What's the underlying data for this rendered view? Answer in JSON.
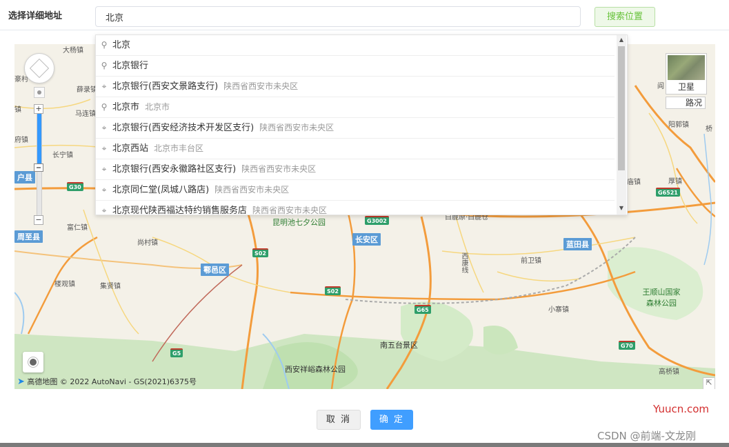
{
  "form": {
    "label": "选择详细地址",
    "input_value": "北京",
    "search_button": "搜索位置"
  },
  "suggestions": [
    {
      "icon": "search-icon",
      "name": "北京",
      "addr": ""
    },
    {
      "icon": "search-icon",
      "name": "北京银行",
      "addr": ""
    },
    {
      "icon": "pin-icon",
      "name": "北京银行(西安文景路支行)",
      "addr": "陕西省西安市未央区"
    },
    {
      "icon": "search-icon",
      "name": "北京市",
      "addr": "北京市"
    },
    {
      "icon": "pin-icon",
      "name": "北京银行(西安经济技术开发区支行)",
      "addr": "陕西省西安市未央区"
    },
    {
      "icon": "pin-icon",
      "name": "北京西站",
      "addr": "北京市丰台区"
    },
    {
      "icon": "pin-icon",
      "name": "北京银行(西安永徽路社区支行)",
      "addr": "陕西省西安市未央区"
    },
    {
      "icon": "pin-icon",
      "name": "北京同仁堂(凤城八路店)",
      "addr": "陕西省西安市未央区"
    },
    {
      "icon": "pin-icon",
      "name": "北京现代陕西福达特约销售服务店",
      "addr": "陕西省西安市未央区"
    }
  ],
  "map": {
    "satellite_label": "卫星",
    "road_label": "路况",
    "attribution_brand": "高德地图",
    "attribution_text": "© 2022 AutoNavi - GS(2021)6375号",
    "labels": {
      "dayangzhen": "大杨镇",
      "xuejiazhen": "薛录镇",
      "majiazhen": "马连镇",
      "changningzhen": "长宁镇",
      "fuzhen": "府镇",
      "zhen1": "镇",
      "huzhen": "豪村",
      "wanghu": "阎",
      "yanglaozhen": "阳郭镇",
      "qiao": "桥",
      "dianzhen": "庙镇",
      "houzhen": "厚镇",
      "furenzhen": "富仁镇",
      "shangcunzhen": "尚村镇",
      "louguanzhen": "楼观镇",
      "jixianzhen": "集贤镇",
      "kunming": "昆明池七夕公园",
      "bailuyuan": "白鹿原·白鹿仓",
      "xikangxian": "西康线",
      "qianweizhen": "前卫镇",
      "xiaozhaizhen": "小寨镇",
      "nanwutai": "南五台景区",
      "xiangyu": "西安祥峪森林公园",
      "wangshun": "王顺山国家森林公园",
      "gaoqiao": "高桥镇"
    },
    "districts": {
      "huxian": "户县",
      "zhouzhi": "周至县",
      "huyi": "鄠邑区",
      "changan": "长安区",
      "lantian": "蓝田县"
    },
    "shields": {
      "g30": "G30",
      "g3002": "G3002",
      "s02a": "S02",
      "s02b": "S02",
      "g65": "G65",
      "g6521": "G6521",
      "g70": "G70",
      "g5": "G5"
    }
  },
  "footer": {
    "cancel": "取 消",
    "ok": "确 定"
  },
  "watermarks": {
    "site": "Yuucn.com",
    "csdn": "CSDN @前端-文龙刚"
  }
}
